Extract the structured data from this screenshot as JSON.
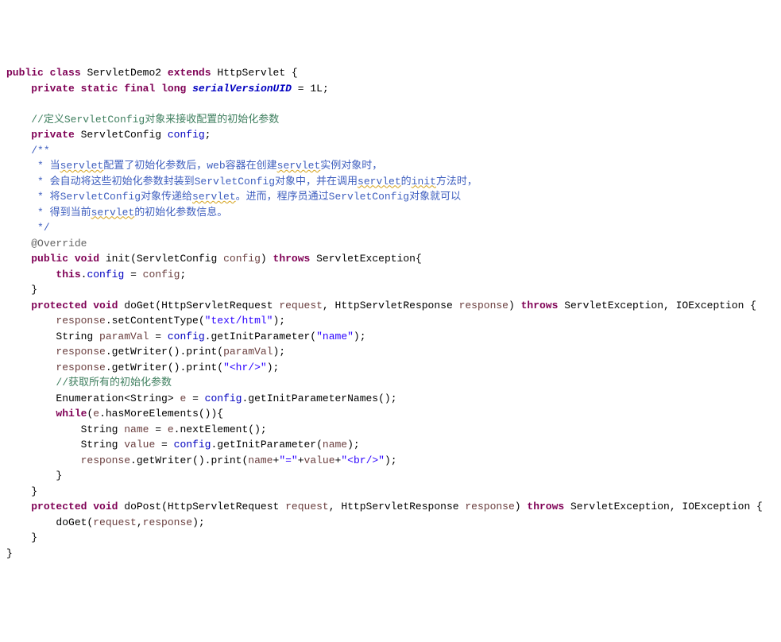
{
  "code": {
    "l1_public": "public",
    "l1_class": "class",
    "l1_classname": "ServletDemo2",
    "l1_extends": "extends",
    "l1_supertype": "HttpServlet {",
    "l2_private": "private",
    "l2_static": "static",
    "l2_final": "final",
    "l2_long": "long",
    "l2_field": "serialVersionUID",
    "l2_rest": " = 1L;",
    "l3_blank": "",
    "l4_comment": "//定义ServletConfig对象来接收配置的初始化参数",
    "l5_private": "private",
    "l5_type": " ServletConfig ",
    "l5_field": "config",
    "l5_semi": ";",
    "l6": "/**",
    "l7a": " * 当",
    "l7b": "servlet",
    "l7c": "配置了初始化参数后，web容器在创建",
    "l7d": "servlet",
    "l7e": "实例对象时，",
    "l8a": " * 会自动将这些初始化参数封装到ServletConfig对象中，并在调用",
    "l8b": "servlet",
    "l8c": "的",
    "l8d": "init",
    "l8e": "方法时，",
    "l9a": " * 将ServletConfig对象传递给",
    "l9b": "servlet",
    "l9c": "。进而，程序员通过ServletConfig对象就可以",
    "l10a": " * 得到当前",
    "l10b": "servlet",
    "l10c": "的初始化参数信息。",
    "l11": " */",
    "l12": "@Override",
    "l13_public": "public",
    "l13_void": "void",
    "l13_method": " init(ServletConfig ",
    "l13_param": "config",
    "l13_after": ") ",
    "l13_throws": "throws",
    "l13_exc": " ServletException{",
    "l14_this": "this",
    "l14_dot": ".",
    "l14_field": "config",
    "l14_eq": " = ",
    "l14_param": "config",
    "l14_semi": ";",
    "l15": "}",
    "l16_protected": "protected",
    "l16_void": "void",
    "l16_method": " doGet(HttpServletRequest ",
    "l16_p1": "request",
    "l16_mid": ", HttpServletResponse ",
    "l16_p2": "response",
    "l16_after": ") ",
    "l16_throws": "throws",
    "l16_exc": " ServletException, IOException {",
    "l17_a": "response",
    "l17_b": ".setContentType(",
    "l17_s": "\"text/html\"",
    "l17_c": ");",
    "l18_a": "String ",
    "l18_var": "paramVal",
    "l18_b": " = ",
    "l18_field": "config",
    "l18_c": ".getInitParameter(",
    "l18_s": "\"name\"",
    "l18_d": ");",
    "l19_a": "response",
    "l19_b": ".getWriter().print(",
    "l19_var": "paramVal",
    "l19_c": ");",
    "l20_a": "response",
    "l20_b": ".getWriter().print(",
    "l20_s": "\"<hr/>\"",
    "l20_c": ");",
    "l21": "//获取所有的初始化参数",
    "l22_a": "Enumeration<String> ",
    "l22_var": "e",
    "l22_b": " = ",
    "l22_field": "config",
    "l22_c": ".getInitParameterNames();",
    "l23_while": "while",
    "l23_a": "(",
    "l23_var": "e",
    "l23_b": ".hasMoreElements()){",
    "l24_a": "String ",
    "l24_var": "name",
    "l24_b": " = ",
    "l24_var2": "e",
    "l24_c": ".nextElement();",
    "l25_a": "String ",
    "l25_var": "value",
    "l25_b": " = ",
    "l25_field": "config",
    "l25_c": ".getInitParameter(",
    "l25_var2": "name",
    "l25_d": ");",
    "l26_a": "response",
    "l26_b": ".getWriter().print(",
    "l26_var1": "name",
    "l26_c": "+",
    "l26_s1": "\"=\"",
    "l26_d": "+",
    "l26_var2": "value",
    "l26_e": "+",
    "l26_s2": "\"<br/>\"",
    "l26_f": ");",
    "l27": "}",
    "l28": "}",
    "l29_protected": "protected",
    "l29_void": "void",
    "l29_method": " doPost(HttpServletRequest ",
    "l29_p1": "request",
    "l29_mid": ", HttpServletResponse ",
    "l29_p2": "response",
    "l29_after": ") ",
    "l29_throws": "throws",
    "l29_exc": " ServletException, IOException {",
    "l30_a": "doGet(",
    "l30_p1": "request",
    "l30_b": ",",
    "l30_p2": "response",
    "l30_c": ");",
    "l31": "}",
    "l32": "}"
  }
}
